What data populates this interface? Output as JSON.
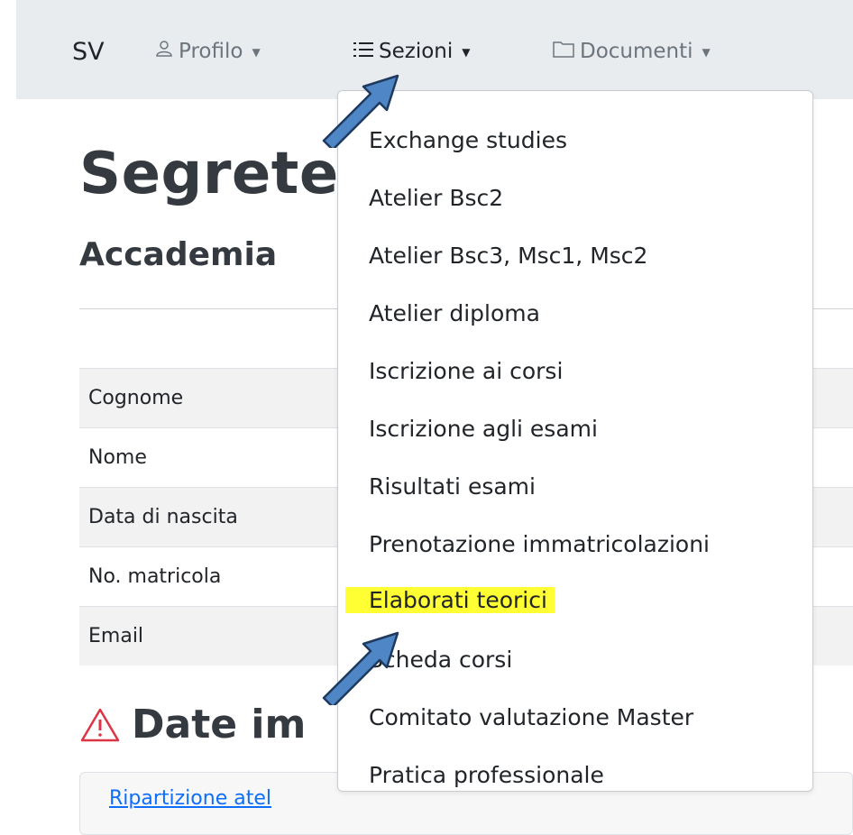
{
  "nav": {
    "brand": "SV",
    "items": [
      {
        "label": "Profilo",
        "icon": "person-icon"
      },
      {
        "label": "Sezioni",
        "icon": "list-icon"
      },
      {
        "label": "Documenti",
        "icon": "folder-icon"
      }
    ]
  },
  "page": {
    "title": "Segrete",
    "subtitle": "Accademia"
  },
  "student_table": {
    "rows": [
      "Cognome",
      "Nome",
      "Data di nascita",
      "No. matricola",
      "Email"
    ]
  },
  "alert": {
    "heading": "Date im",
    "icon": "warning-icon",
    "link": "Ripartizione atel"
  },
  "dropdown": {
    "items": [
      "Exchange studies",
      "Atelier Bsc2",
      "Atelier Bsc3, Msc1, Msc2",
      "Atelier diploma",
      "Iscrizione ai corsi",
      "Iscrizione agli esami",
      "Risultati esami",
      "Prenotazione immatricolazioni",
      "Elaborati teorici",
      "Scheda corsi",
      "Comitato valutazione Master",
      "Pratica professionale"
    ],
    "highlighted_index": 8,
    "highlight_color": "#ffff33"
  },
  "colors": {
    "navbar_bg": "#e9ecef",
    "link": "#0d6efd",
    "arrow_fill": "#4f86c6",
    "arrow_stroke": "#1f3a5f",
    "warning": "#dc3545"
  }
}
